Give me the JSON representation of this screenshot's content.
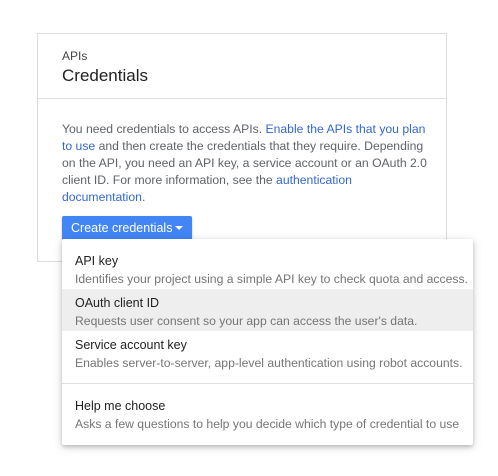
{
  "card": {
    "eyebrow": "APIs",
    "title": "Credentials",
    "description": {
      "part1": "You need credentials to access APIs. ",
      "link1": "Enable the APIs that you plan to use",
      "part2": " and then create the credentials that they require. Depending on the API, you need an API key, a service account or an OAuth 2.0 client ID. For more information, see the ",
      "link2": "authentication documentation",
      "part3": "."
    },
    "create_button_label": "Create credentials"
  },
  "menu": {
    "items": [
      {
        "title": "API key",
        "subtitle": "Identifies your project using a simple API key to check quota and access."
      },
      {
        "title": "OAuth client ID",
        "subtitle": "Requests user consent so your app can access the user's data."
      },
      {
        "title": "Service account key",
        "subtitle": "Enables server-to-server, app-level authentication using robot accounts."
      },
      {
        "title": "Help me choose",
        "subtitle": "Asks a few questions to help you decide which type of credential to use"
      }
    ]
  },
  "colors": {
    "accent": "#4285f4",
    "link": "#3367d6",
    "highlight": "#eeeeee"
  },
  "icons": {
    "dropdown": "caret-down-icon"
  }
}
